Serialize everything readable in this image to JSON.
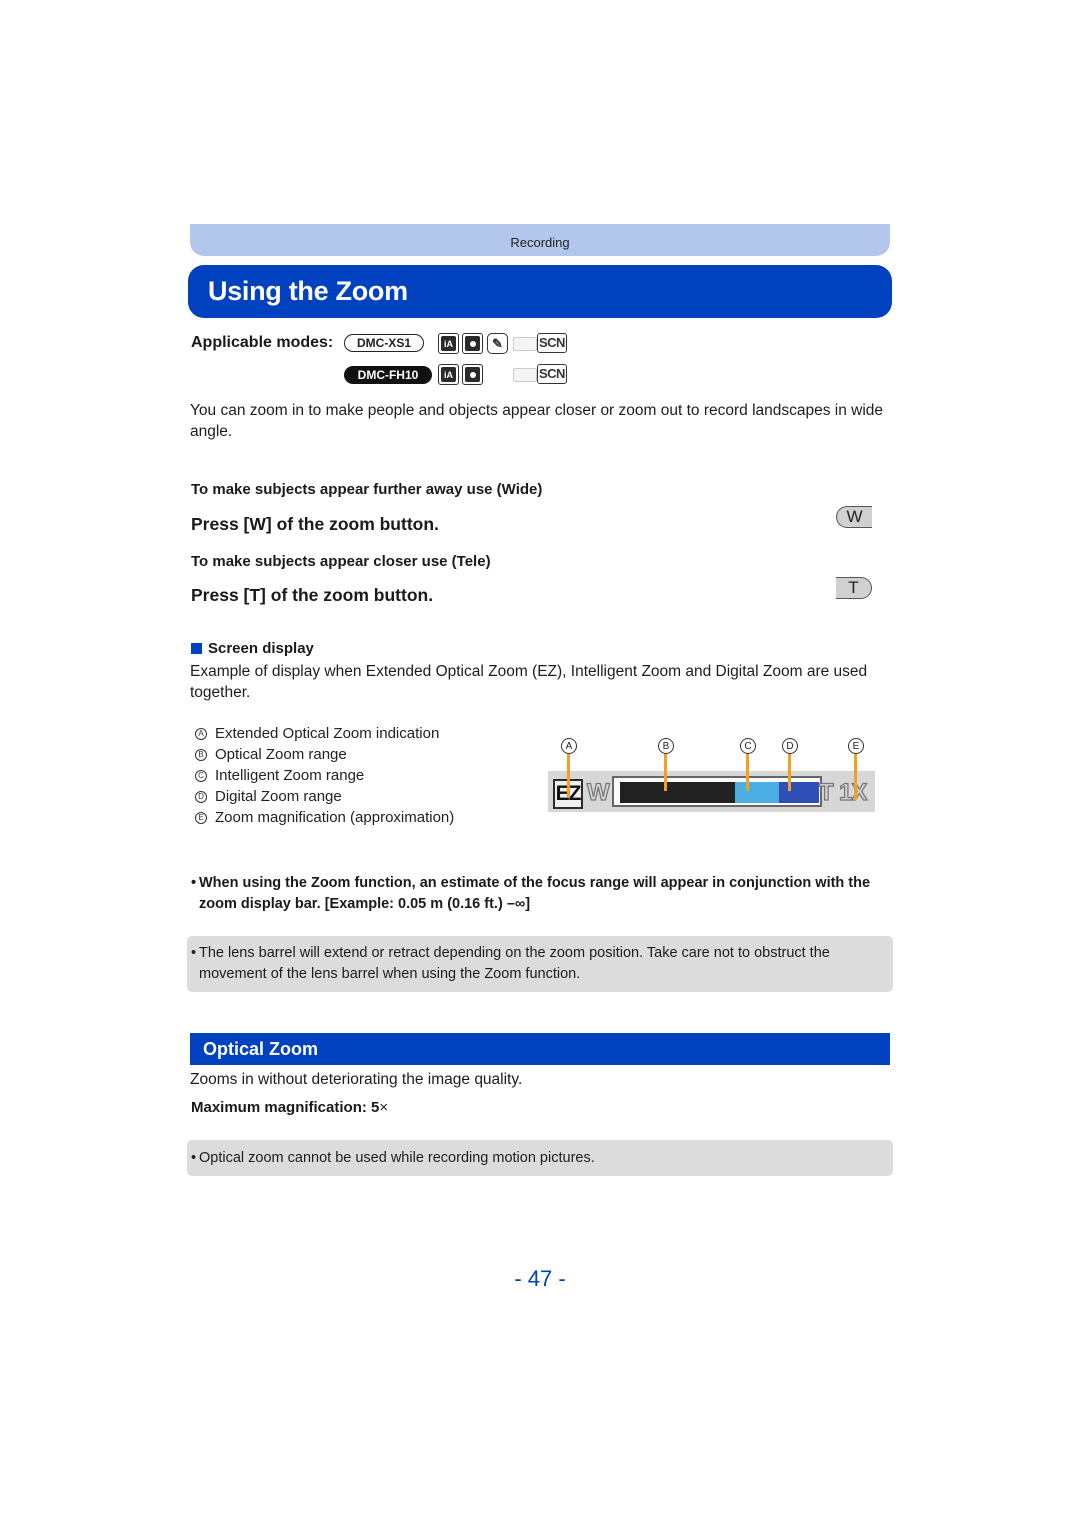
{
  "header": {
    "section": "Recording",
    "title": "Using the Zoom"
  },
  "applicable_modes": {
    "label": "Applicable modes:",
    "models": [
      {
        "name": "DMC-XS1",
        "style": "outline",
        "modes": [
          "iA",
          "camera",
          "clipboard",
          "panorama-faded",
          "SCN"
        ]
      },
      {
        "name": "DMC-FH10",
        "style": "filled",
        "modes": [
          "iA",
          "camera",
          "panorama-faded",
          "SCN"
        ]
      }
    ],
    "icons": {
      "ia": "iA",
      "scn": "SCN",
      "clipboard": "✎"
    }
  },
  "intro": "You can zoom in to make people and objects appear closer or zoom out to record landscapes in wide angle.",
  "wide": {
    "heading": "To make subjects appear further away use (Wide)",
    "instruction": "Press [W] of the zoom button.",
    "key": "W"
  },
  "tele": {
    "heading": "To make subjects appear closer use (Tele)",
    "instruction": "Press [T] of the zoom button.",
    "key": "T"
  },
  "screen_display": {
    "heading": "Screen display",
    "description": "Example of display when Extended Optical Zoom (EZ), Intelligent Zoom and Digital Zoom are used together.",
    "legend": [
      {
        "letter": "A",
        "text": "Extended Optical Zoom indication"
      },
      {
        "letter": "B",
        "text": "Optical Zoom range"
      },
      {
        "letter": "C",
        "text": "Intelligent Zoom range"
      },
      {
        "letter": "D",
        "text": "Digital Zoom range"
      },
      {
        "letter": "E",
        "text": "Zoom magnification (approximation)"
      }
    ],
    "zoom_bar": {
      "ez_label": "EZ",
      "w_label": "W",
      "t_label": "T",
      "magnification": "1X",
      "segments": [
        {
          "name": "optical",
          "fraction": 0.58,
          "color": "#222222"
        },
        {
          "name": "intelligent",
          "fraction": 0.22,
          "color": "#4aaee3"
        },
        {
          "name": "digital",
          "fraction": 0.2,
          "color": "#2e4fb5"
        }
      ],
      "pointer_color": "#f5a01a"
    }
  },
  "focus_note": "When using the Zoom function, an estimate of the focus range will appear in conjunction with the zoom display bar. [Example:  0.05 m (0.16 ft.) –∞]",
  "lens_note": "The lens barrel will extend or retract depending on the zoom position. Take care not to obstruct the movement of the lens barrel when using the Zoom function.",
  "optical_zoom": {
    "heading": "Optical Zoom",
    "description": "Zooms in without deteriorating the image quality.",
    "max_label": "Maximum magnification: 5",
    "max_suffix": "×",
    "note": "Optical zoom cannot be used while recording motion pictures."
  },
  "bullet": "•",
  "page_number": "- 47 -",
  "colors": {
    "brand_blue": "#0041c0",
    "section_bar": "#b3c6ec",
    "note_bg": "#dcdcdc"
  }
}
